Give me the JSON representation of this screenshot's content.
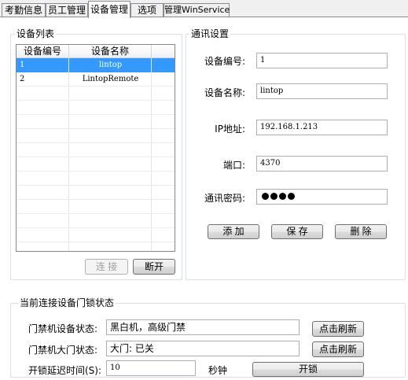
{
  "tabs": [
    "考勤信息",
    "员工管理",
    "设备管理",
    "选项",
    "管理WinService"
  ],
  "active_tab_index": 2,
  "device_list": {
    "title": "设备列表",
    "columns": [
      "设备编号",
      "设备名称"
    ],
    "rows": [
      {
        "id": "1",
        "name": "lintop",
        "selected": true
      },
      {
        "id": "2",
        "name": "LintopRemote",
        "selected": false
      }
    ],
    "connect_label": "连 接",
    "disconnect_label": "断开"
  },
  "comm_settings": {
    "title": "通讯设置",
    "device_id_label": "设备编号:",
    "device_id_value": "1",
    "device_name_label": "设备名称:",
    "device_name_value": "lintop",
    "ip_label": "IP地址:",
    "ip_value": "192.168.1.213",
    "port_label": "端口:",
    "port_value": "4370",
    "password_label": "通讯密码:",
    "password_mask_count": 4,
    "add_label": "添 加",
    "save_label": "保 存",
    "delete_label": "删 除"
  },
  "status": {
    "title": "当前连接设备门锁状态",
    "device_status_label": "门禁机设备状态:",
    "device_status_value": "黑白机，高级门禁",
    "refresh1_label": "点击刷新",
    "door_status_label": "门禁机大门状态:",
    "door_status_value": "大门: 已关",
    "refresh2_label": "点击刷新",
    "unlock_delay_label": "开锁延迟时间(S):",
    "unlock_delay_value": "10",
    "unit_label": "秒钟",
    "unlock_label": "开锁"
  }
}
